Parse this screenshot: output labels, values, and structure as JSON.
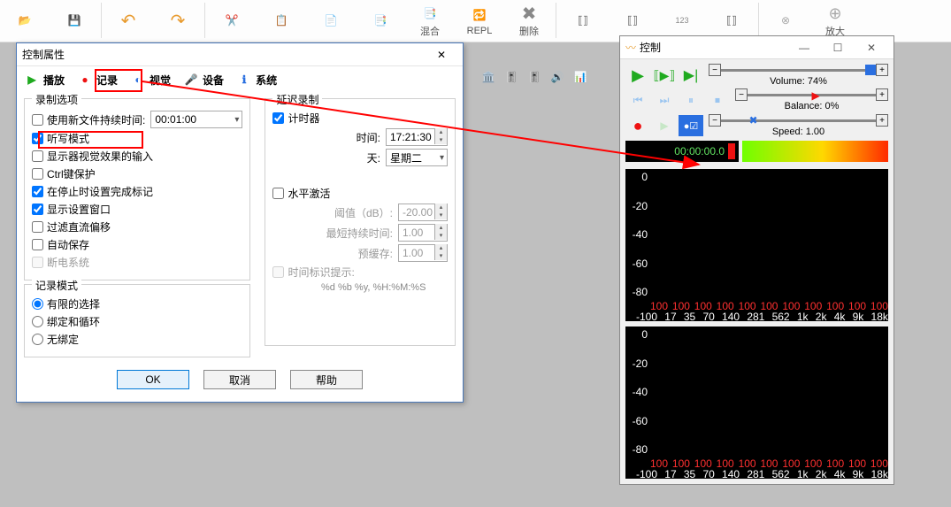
{
  "toolbar": {
    "items": [
      "",
      "",
      "",
      "",
      "",
      "",
      "",
      "",
      "",
      "混合",
      "REPL",
      "删除",
      "",
      "",
      "",
      "",
      "",
      "",
      "放大"
    ]
  },
  "dialog": {
    "title": "控制属性",
    "tabs": {
      "play": "播放",
      "record": "记录",
      "visual": "视觉",
      "device": "设备",
      "system": "系统"
    },
    "rec_options": {
      "legend": "录制选项",
      "use_duration": "使用新文件持续时间:",
      "duration_value": "00:01:00",
      "dictation_mode": "听写模式",
      "display_visual_output": "显示器视觉效果的输入",
      "ctrl_protect": "Ctrl键保护",
      "set_done_marker": "在停止时设置完成标记",
      "show_settings_window": "显示设置窗口",
      "filter_dc": "过滤直流偏移",
      "auto_save": "自动保存",
      "power_off": "断电系统"
    },
    "record_mode": {
      "legend": "记录模式",
      "limited": "有限的选择",
      "bind_loop": "绑定和循环",
      "unbound": "无绑定"
    },
    "delay_rec": {
      "legend": "延迟录制",
      "timer": "计时器",
      "time_label": "时间:",
      "time_value": "17:21:30",
      "day_label": "天:",
      "day_value": "星期二",
      "horiz_activate": "水平激活",
      "threshold_label": "阈值（dB）:",
      "threshold_value": "-20.00",
      "min_duration_label": "最短持续时间:",
      "min_duration_value": "1.00",
      "prebuffer_label": "预缓存:",
      "prebuffer_value": "1.00",
      "time_marker_label": "时间标识提示:",
      "time_format": "%d %b %y, %H:%M:%S"
    },
    "buttons": {
      "ok": "OK",
      "cancel": "取消",
      "help": "帮助"
    }
  },
  "panel": {
    "title": "控制",
    "volume_label": "Volume: 74%",
    "balance_label": "Balance: 0%",
    "speed_label": "Speed: 1.00",
    "timer": "00:00:00.0",
    "y_scale": [
      "0",
      "-20",
      "-40",
      "-60",
      "-80",
      "-100"
    ],
    "peaks": [
      "100",
      "100",
      "100",
      "100",
      "100",
      "100",
      "100",
      "100",
      "100",
      "100",
      "100"
    ],
    "freqs": [
      "17",
      "35",
      "70",
      "140",
      "281",
      "562",
      "1k",
      "2k",
      "4k",
      "9k",
      "18k"
    ]
  }
}
